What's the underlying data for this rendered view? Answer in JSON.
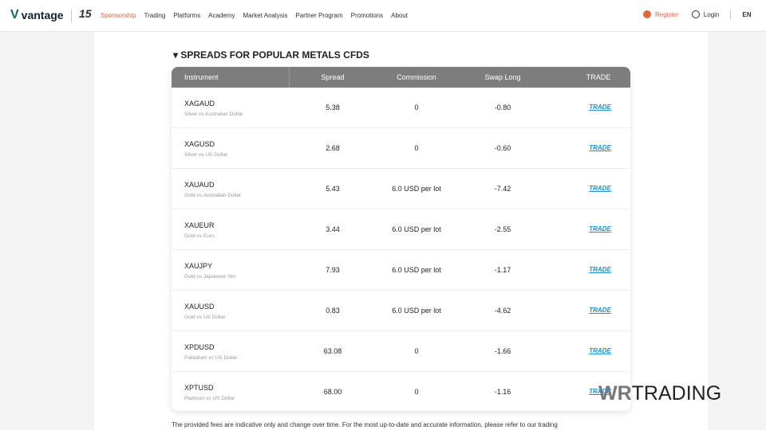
{
  "nav": {
    "logo": "vantage",
    "badge": "15",
    "items": [
      "Sponsorship",
      "Trading",
      "Platforms",
      "Academy",
      "Market Analysis",
      "Partner Program",
      "Promotions",
      "About"
    ],
    "register": "Register",
    "login": "Login",
    "lang": "EN"
  },
  "section_title": "SPREADS FOR POPULAR METALS CFDS",
  "table": {
    "headers": [
      "Instrument",
      "Spread",
      "Commission",
      "Swap Long",
      "TRADE"
    ],
    "rows": [
      {
        "symbol": "XAGAUD",
        "desc": "Silver vs Australian Dollar",
        "spread": "5.38",
        "commission": "0",
        "swap": "-0.80",
        "trade": "TRADE"
      },
      {
        "symbol": "XAGUSD",
        "desc": "Silver vs US Dollar",
        "spread": "2.68",
        "commission": "0",
        "swap": "-0.60",
        "trade": "TRADE"
      },
      {
        "symbol": "XAUAUD",
        "desc": "Gold vs Australian Dollar",
        "spread": "5.43",
        "commission": "6.0 USD per lot",
        "swap": "-7.42",
        "trade": "TRADE"
      },
      {
        "symbol": "XAUEUR",
        "desc": "Gold vs Euro",
        "spread": "3.44",
        "commission": "6.0 USD per lot",
        "swap": "-2.55",
        "trade": "TRADE"
      },
      {
        "symbol": "XAUJPY",
        "desc": "Gold vs Japanese Yen",
        "spread": "7.93",
        "commission": "6.0 USD per lot",
        "swap": "-1.17",
        "trade": "TRADE"
      },
      {
        "symbol": "XAUUSD",
        "desc": "Gold vs US Dollar",
        "spread": "0.83",
        "commission": "6.0 USD per lot",
        "swap": "-4.62",
        "trade": "TRADE"
      },
      {
        "symbol": "XPDUSD",
        "desc": "Palladium vs US Dollar",
        "spread": "63.08",
        "commission": "0",
        "swap": "-1.66",
        "trade": "TRADE"
      },
      {
        "symbol": "XPTUSD",
        "desc": "Platinum vs US Dollar",
        "spread": "68.00",
        "commission": "0",
        "swap": "-1.16",
        "trade": "TRADE"
      }
    ]
  },
  "note": "The provided fees are indicative only and change over time. For the most up-to-date and accurate information, please refer to our trading",
  "watermark": {
    "prefix": "WR",
    "text": "TRADING"
  }
}
